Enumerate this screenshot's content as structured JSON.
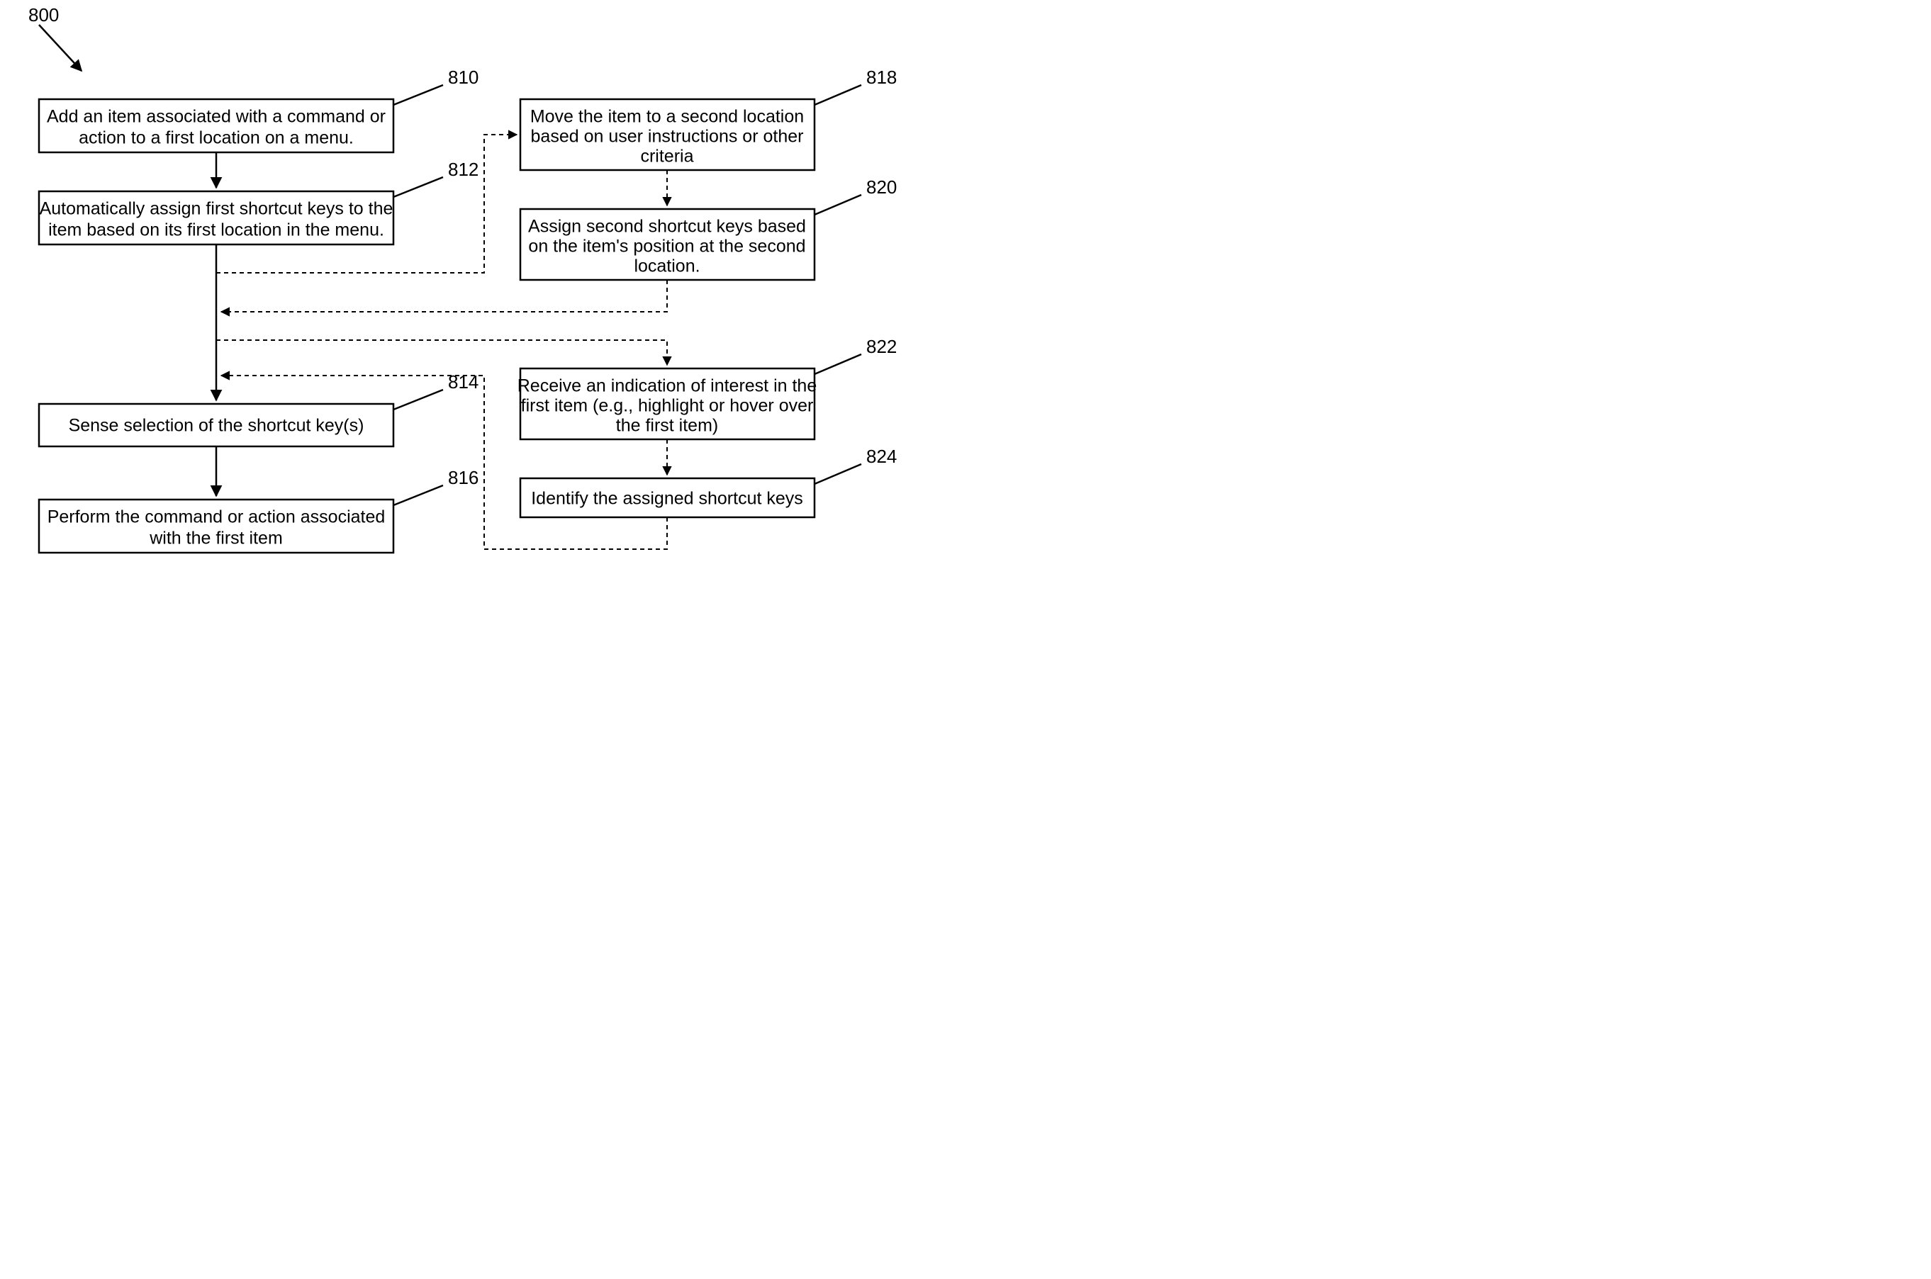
{
  "flowchart": {
    "figure_label": "800",
    "boxes": {
      "b810": {
        "ref": "810",
        "line1": "Add an item associated with a command or",
        "line2": "action to a first location on a menu."
      },
      "b812": {
        "ref": "812",
        "line1": "Automatically assign first shortcut keys to the",
        "line2": "item based on its first location in the menu."
      },
      "b814": {
        "ref": "814",
        "line1": "Sense selection of the shortcut key(s)"
      },
      "b816": {
        "ref": "816",
        "line1": "Perform the command or action associated",
        "line2": "with the first item"
      },
      "b818": {
        "ref": "818",
        "line1": "Move the item to a second location",
        "line2": "based on user instructions or other",
        "line3": "criteria"
      },
      "b820": {
        "ref": "820",
        "line1": "Assign second shortcut keys based",
        "line2": "on the item's position at the second",
        "line3": "location."
      },
      "b822": {
        "ref": "822",
        "line1": "Receive an indication of interest in the",
        "line2": "first item (e.g., highlight or hover over",
        "line3": "the first item)"
      },
      "b824": {
        "ref": "824",
        "line1": "Identify the assigned shortcut keys"
      }
    }
  }
}
